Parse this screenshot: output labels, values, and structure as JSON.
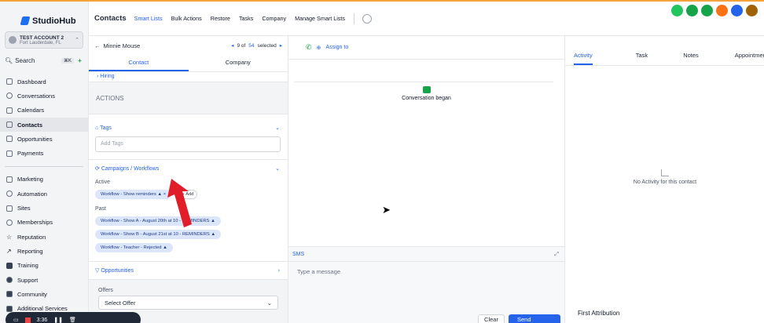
{
  "brand": {
    "name": "StudioHub"
  },
  "account": {
    "name": "TEST ACCOUNT 2",
    "location": "Fort Lauderdale, FL"
  },
  "search": {
    "label": "Search",
    "shortcut": "⌘K"
  },
  "sidebar": {
    "items": [
      {
        "label": "Dashboard",
        "icon": "dashboard-icon"
      },
      {
        "label": "Conversations",
        "icon": "chat-icon"
      },
      {
        "label": "Calendars",
        "icon": "calendar-icon"
      },
      {
        "label": "Contacts",
        "icon": "contacts-icon",
        "active": true
      },
      {
        "label": "Opportunities",
        "icon": "opportunities-icon"
      },
      {
        "label": "Payments",
        "icon": "payments-icon"
      }
    ],
    "items2": [
      {
        "label": "Marketing",
        "icon": "send-icon"
      },
      {
        "label": "Automation",
        "icon": "automation-icon"
      },
      {
        "label": "Sites",
        "icon": "sites-icon"
      },
      {
        "label": "Memberships",
        "icon": "membership-icon"
      },
      {
        "label": "Reputation",
        "icon": "star-icon"
      },
      {
        "label": "Reporting",
        "icon": "chart-icon"
      },
      {
        "label": "Training",
        "icon": "book-icon"
      },
      {
        "label": "Support",
        "icon": "support-icon"
      },
      {
        "label": "Community",
        "icon": "community-icon"
      },
      {
        "label": "Additional Services",
        "icon": "services-icon"
      }
    ]
  },
  "header": {
    "title": "Contacts",
    "tabs": [
      "Smart Lists",
      "Bulk Actions",
      "Restore",
      "Tasks",
      "Company",
      "Manage Smart Lists"
    ]
  },
  "contact": {
    "name": "Minnie Mouse",
    "pager": {
      "current": "9 of",
      "total": "54",
      "selected": "selected"
    },
    "tabs": [
      "Contact",
      "Company"
    ],
    "hiring": "Hiring",
    "actions": "ACTIONS",
    "tags": {
      "title": "Tags",
      "placeholder": "Add Tags"
    },
    "campaigns": {
      "title": "Campaigns / Workflows",
      "active_label": "Active",
      "active": [
        "Workflow - Show reminders"
      ],
      "add": "+ Add",
      "past_label": "Past",
      "past": [
        "Workflow - Show A - August 20th at 10 - REMINDERS",
        "Workflow - Show B - August 21st at 10 - REMINDERS",
        "Workflow - Teacher - Rejected"
      ]
    },
    "opportunities": "Opportunities",
    "offers": {
      "label": "Offers",
      "select": "Select Offer"
    }
  },
  "conversation": {
    "assign": "Assign to",
    "began": "Conversation began",
    "sms_tab": "SMS",
    "placeholder": "Type a message",
    "clear": "Clear",
    "send": "Send"
  },
  "activity": {
    "tabs": [
      "Activity",
      "Task",
      "Notes",
      "Appointment"
    ],
    "empty": "No Activity for this contact",
    "first_attribution": "First Attribution"
  },
  "recorder": {
    "time": "3:36"
  },
  "colors": {
    "accent": "#2563eb",
    "arrow": "#e11d2a",
    "green": "#16a34a",
    "orange": "#f7a33c"
  }
}
